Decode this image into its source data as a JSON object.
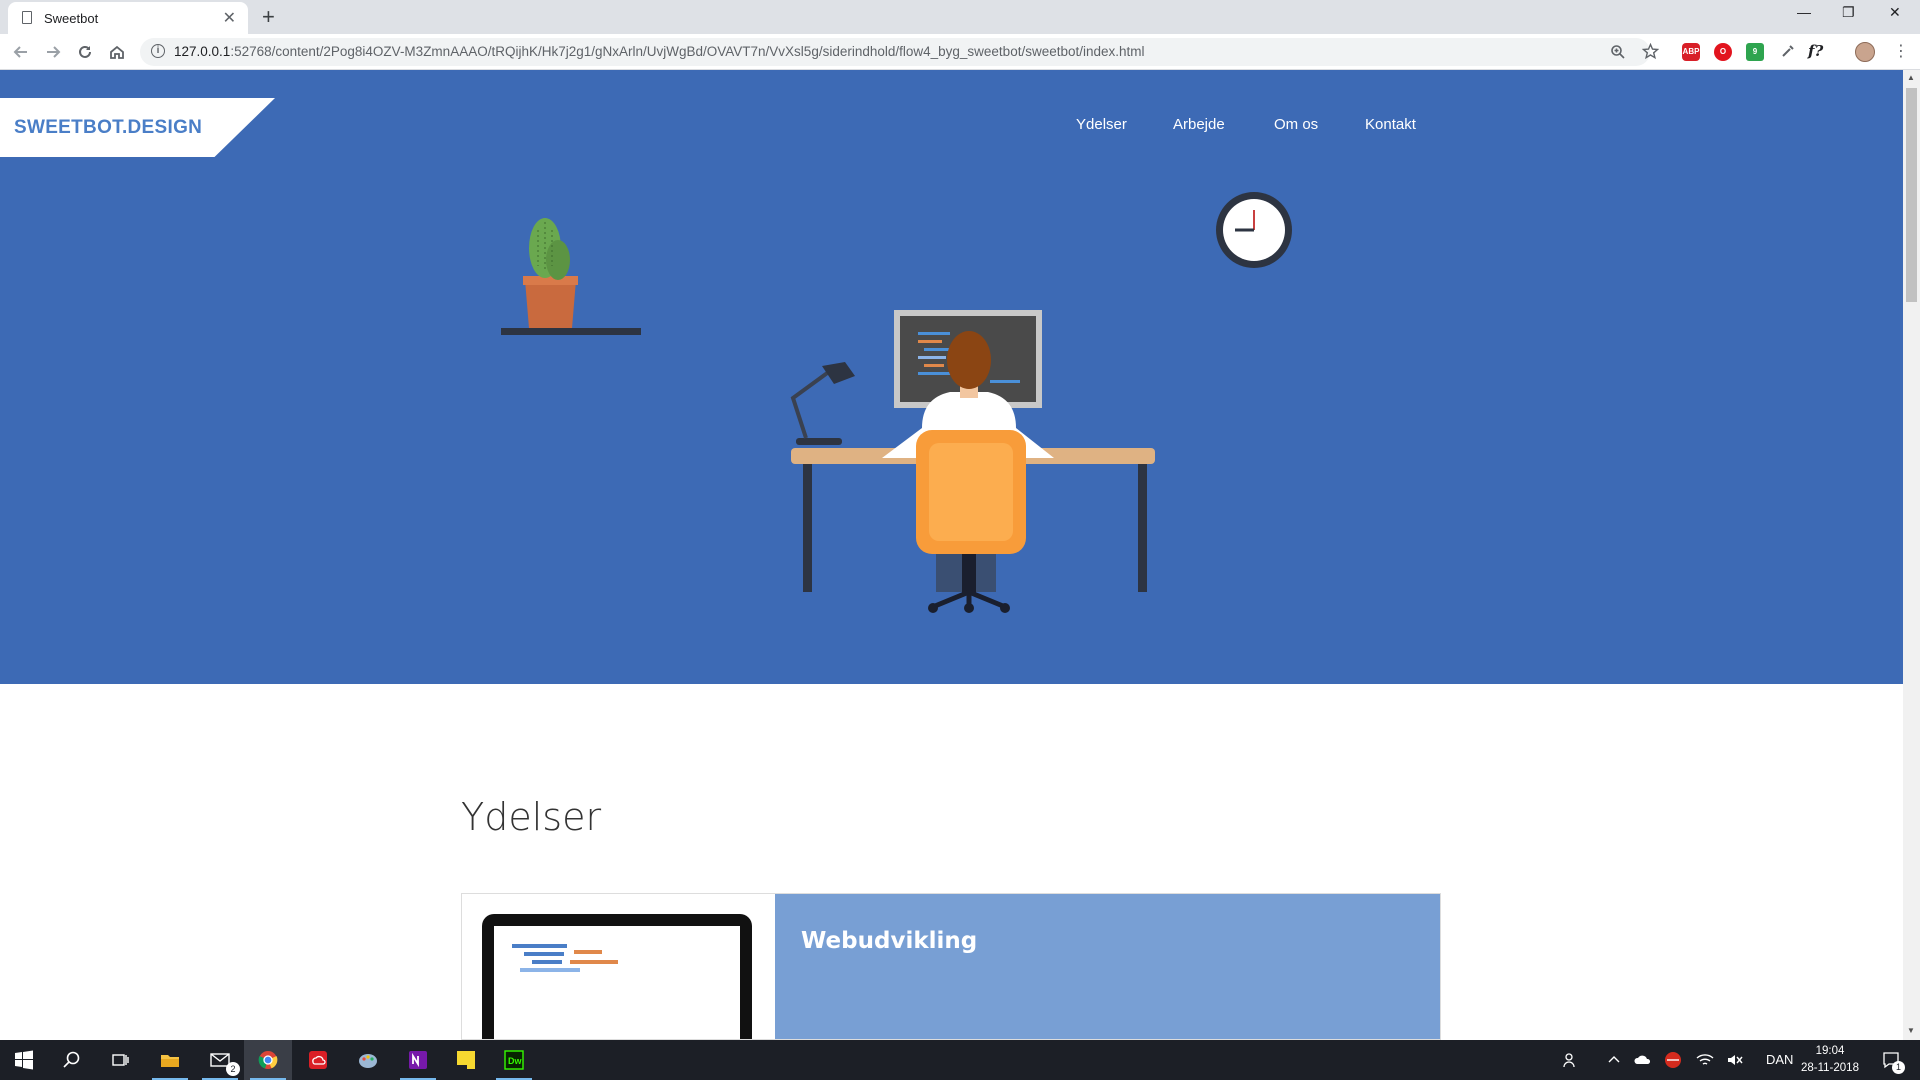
{
  "browser": {
    "tab_title": "Sweetbot",
    "tab_close": "✕",
    "new_tab": "+",
    "window_controls": [
      "—",
      "❐",
      "✕"
    ],
    "url_host": "127.0.0.1",
    "url_rest": ":52768/content/2Pog8i4OZV-M3ZmnAAAO/tRQijhK/Hk7j2g1/gNxArln/UvjWgBd/OVAVT7n/VvXsl5g/siderindhold/flow4_byg_sweetbot/sweetbot/index.html",
    "nav_icons": [
      "back-arrow-icon",
      "forward-arrow-icon",
      "reload-icon",
      "home-icon"
    ],
    "extensions": [
      "ABP",
      "O",
      "9",
      "f?"
    ]
  },
  "site": {
    "logo": "SWEETBOT.DESIGN",
    "nav": [
      "Ydelser",
      "Arbejde",
      "Om os",
      "Kontakt"
    ],
    "section_title": "Ydelser",
    "card_title": "Webudvikling",
    "colors": {
      "hero_bg": "#3d6ab5",
      "card_bg": "#789fd4",
      "logo_text": "#4a7ec7"
    }
  },
  "taskbar": {
    "mail_badge": "2",
    "language": "DAN",
    "time": "19:04",
    "date": "28-11-2018",
    "notification_count": "1"
  }
}
